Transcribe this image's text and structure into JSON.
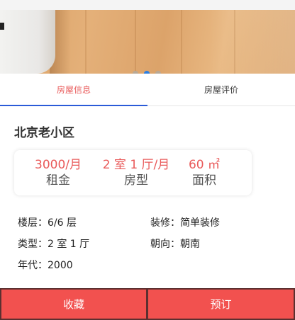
{
  "carousel": {
    "dots": [
      false,
      true,
      false
    ]
  },
  "tabs": [
    {
      "label": "房屋信息",
      "active": true
    },
    {
      "label": "房屋评价",
      "active": false
    }
  ],
  "house": {
    "title": "北京老小区",
    "stats": [
      {
        "value": "3000/月",
        "label": "租金"
      },
      {
        "value": "2 室 1 厅/月",
        "label": "房型"
      },
      {
        "value": "60 ㎡",
        "label": "面积"
      }
    ],
    "info": {
      "floor": "楼层：6/6 层",
      "decoration": "装修：简单装修",
      "type": "类型：2 室 1 厅",
      "orientation": "朝向：朝南",
      "year": "年代：2000"
    }
  },
  "actions": {
    "favorite": "收藏",
    "book": "预订"
  },
  "colors": {
    "accent": "#e95a5a",
    "button": "#f2514f",
    "tab_indicator": "#2b5bd8",
    "active_dot": "#2f7fe0"
  }
}
